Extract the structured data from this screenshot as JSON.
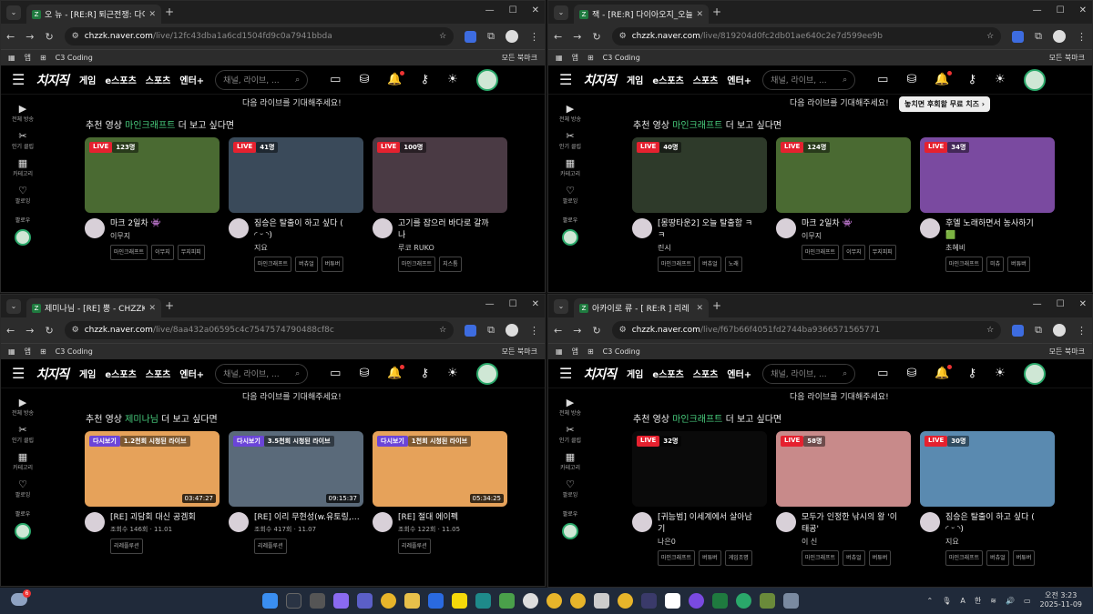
{
  "windows": [
    {
      "tab_title": "오 뉴 - [RE:R] 퇴근전쟁: 다이아",
      "url_host": "chzzk.naver.com",
      "url_path": "/live/12fc43dba1a6cd1504fd9c0a7941bbda",
      "rec_prefix": "추천 영상",
      "rec_category": "마인크래프트",
      "rec_suffix": "더 보고 싶다면",
      "next_live": "다음 라이브를 기대해주세요!",
      "tooltip": null,
      "cards": [
        {
          "badge_type": "live",
          "badge": "LIVE",
          "viewers": "123명",
          "title": "마크 2일차 👾",
          "name": "이무지",
          "tags": [
            "마인크래프트",
            "이무지",
            "무지피피"
          ],
          "thumb": "#4a6a32"
        },
        {
          "badge_type": "live",
          "badge": "LIVE",
          "viewers": "41명",
          "title": "짐승은 탈출이 하고 싶다 (",
          "title2": "◜ ᵕ ◝)",
          "name": "지요",
          "tags": [
            "마인크래프트",
            "버츄얼",
            "버튜버"
          ],
          "thumb": "#3a4a5a"
        },
        {
          "badge_type": "live",
          "badge": "LIVE",
          "viewers": "100명",
          "title": "고기를 잡으러 바다로 갈까",
          "title2": "나",
          "name": "루코 RUKO",
          "tags": [
            "마인크래프트",
            "지스톰"
          ],
          "thumb": "#4a3a44"
        }
      ]
    },
    {
      "tab_title": "잭 - [RE:R] 다이아오지_오늘 퇴",
      "url_host": "chzzk.naver.com",
      "url_path": "/live/819204d0fc2db01ae640c2e7d599ee9b",
      "rec_prefix": "추천 영상",
      "rec_category": "마인크래프트",
      "rec_suffix": "더 보고 싶다면",
      "next_live": "다음 라이브를 기대해주세요!",
      "tooltip": "놓치면 후회할 무료 치즈 ›",
      "cards": [
        {
          "badge_type": "live",
          "badge": "LIVE",
          "viewers": "40명",
          "title": "[몽땅타운2] 오늘 탈출함 ㅋ",
          "title2": "ㅋ",
          "name": "린시",
          "tags": [
            "마인크래프트",
            "버츄얼",
            "노래"
          ],
          "thumb": "#2e3a2a"
        },
        {
          "badge_type": "live",
          "badge": "LIVE",
          "viewers": "124명",
          "title": "마크 2일차 👾",
          "name": "이무지",
          "tags": [
            "마인크래프트",
            "이무지",
            "무지피피"
          ],
          "thumb": "#4a6a32"
        },
        {
          "badge_type": "live",
          "badge": "LIVE",
          "viewers": "34명",
          "title": "후엘 노래하면서 농사하기",
          "title2": "🟩",
          "name": "초혜비",
          "tags": [
            "마인크래프트",
            "미츄",
            "버튜버"
          ],
          "thumb": "#7a4aa0"
        }
      ]
    },
    {
      "tab_title": "제미나님 - [RE] 뿡 - CHZZK",
      "url_host": "chzzk.naver.com",
      "url_path": "/live/8aa432a06595c4c7547574790488cf8c",
      "rec_prefix": "추천 영상",
      "rec_category": "제미나님",
      "rec_suffix": "더 보고 싶다면",
      "next_live": "다음 라이브를 기대해주세요!",
      "tooltip": null,
      "cards": [
        {
          "badge_type": "replay",
          "badge": "다시보기",
          "viewers": "1.2천회 시청된 라이브",
          "duration": "03:47:27",
          "title": "[RE] 괴담회 대신 공겜회",
          "name": "",
          "sub": "조회수 146회 · 11.01",
          "tags": [
            "리레플루션"
          ],
          "thumb": "#e6a25a"
        },
        {
          "badge_type": "replay",
          "badge": "다시보기",
          "viewers": "3.5천회 시청된 라이브",
          "duration": "09:15:37",
          "title": "[RE] 이리 무현성(w.유토링,찬우정)",
          "name": "",
          "sub": "조회수 417회 · 11.07",
          "tags": [
            "리레플루션"
          ],
          "thumb": "#5a6a7a"
        },
        {
          "badge_type": "replay",
          "badge": "다시보기",
          "viewers": "1천회 시청된 라이브",
          "duration": "05:34:25",
          "title": "[RE] 절대 에이펙",
          "name": "",
          "sub": "조회수 122회 · 11.05",
          "tags": [
            "리레플루션"
          ],
          "thumb": "#e6a25a"
        }
      ]
    },
    {
      "tab_title": "아카이로 류 - [ RE:R ] 리레 퇴:",
      "url_host": "chzzk.naver.com",
      "url_path": "/live/f67b66f4051fd2744ba9366571565771",
      "rec_prefix": "추천 영상",
      "rec_category": "마인크래프트",
      "rec_suffix": "더 보고 싶다면",
      "next_live": "다음 라이브를 기대해주세요!",
      "tooltip": null,
      "cards": [
        {
          "badge_type": "live",
          "badge": "LIVE",
          "viewers": "32명",
          "title": "[귀능범] 이세계에서 살아남",
          "title2": "기",
          "name": "나은0",
          "tags": [
            "마인크래프트",
            "버튜버",
            "게임조명"
          ],
          "thumb": "#0a0a0a"
        },
        {
          "badge_type": "live",
          "badge": "LIVE",
          "viewers": "58명",
          "title": "모두가 인정한 낚시의 왕 '이",
          "title2": "태공'",
          "name": "이 신",
          "tags": [
            "마인크래프트",
            "버츄얼",
            "버튜버"
          ],
          "thumb": "#c88a8a"
        },
        {
          "badge_type": "live",
          "badge": "LIVE",
          "viewers": "30명",
          "title": "짐승은 탈출이 하고 싶다 (",
          "title2": "◜ ᵕ ◝)",
          "name": "지요",
          "tags": [
            "마인크래프트",
            "버츄얼",
            "버튜버"
          ],
          "thumb": "#5a8ab0"
        }
      ]
    }
  ],
  "chrome": {
    "bookmark_apps": "앱",
    "bookmark_item": "C3 Coding",
    "bookmark_all": "모든 북마크",
    "new_tab": "+",
    "tab_close": "✕"
  },
  "site": {
    "logo": "치지직",
    "menu": [
      "게임",
      "e스포츠",
      "스포츠",
      "엔터+"
    ],
    "search_placeholder": "채널, 라이브, ...",
    "sidebar": [
      "전체 방송",
      "인기 클립",
      "카테고리",
      "팔로잉"
    ],
    "sidebar_follow": "팔로우"
  },
  "taskbar": {
    "weather_badge": "6",
    "time": "오전 3:23",
    "date": "2025-11-09",
    "lang": "한",
    "notify_badge": "5"
  }
}
